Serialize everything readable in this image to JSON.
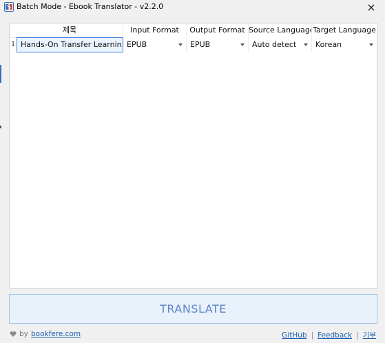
{
  "window": {
    "title": "Batch Mode - Ebook Translator - v2.2.0",
    "close_symbol": "×"
  },
  "table": {
    "columns": [
      "제목",
      "Input Format",
      "Output Format",
      "Source Language",
      "Target Language"
    ],
    "rows": [
      {
        "index": "1",
        "title": "Hands-On Transfer Learnin...",
        "input_format": "EPUB",
        "output_format": "EPUB",
        "source_language": "Auto detect",
        "target_language": "Korean"
      }
    ]
  },
  "translate_button": {
    "label": "TRANSLATE"
  },
  "footer": {
    "by_text": "by",
    "author_link": "bookfere.com",
    "links": [
      "GitHub",
      "Feedback",
      "기부"
    ],
    "separator": "|"
  },
  "colors": {
    "accent": "#3b7fd9",
    "button_bg": "#e9f1fb",
    "button_text": "#5b86c6",
    "link": "#1a5fb4"
  }
}
